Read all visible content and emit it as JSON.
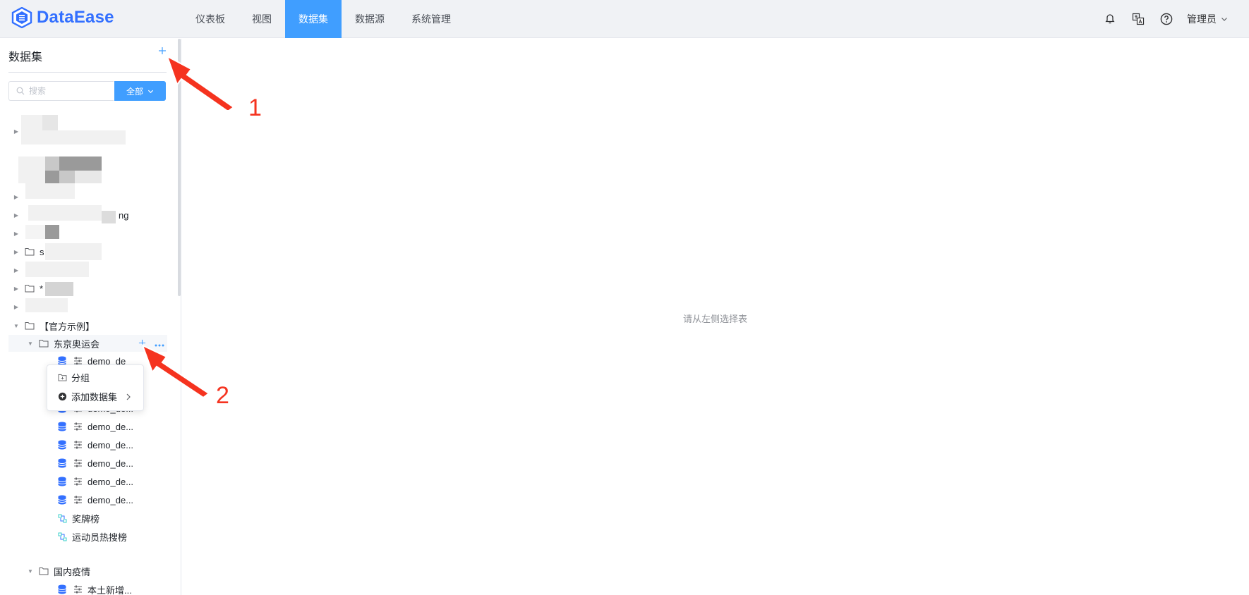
{
  "app": {
    "brand": "DataEase",
    "accent": "#409eff",
    "brand_color": "#3370ff"
  },
  "nav": [
    {
      "label": "仪表板"
    },
    {
      "label": "视图"
    },
    {
      "label": "数据集",
      "active": true
    },
    {
      "label": "数据源"
    },
    {
      "label": "系统管理"
    }
  ],
  "header": {
    "user": "管理员"
  },
  "sidebar": {
    "title": "数据集",
    "search_placeholder": "搜索",
    "filter_label": "全部",
    "partial_rows": [
      {
        "text": "ng"
      },
      {
        "text": "s"
      },
      {
        "text": "*"
      }
    ],
    "folders": {
      "official": "【官方示例】",
      "olympics": "东京奥运会",
      "covid": "国内疫情"
    },
    "datasets": [
      {
        "label": "demo_de"
      },
      {
        "label": "demo_de..."
      },
      {
        "label": "demo_de..."
      },
      {
        "label": "demo_de..."
      },
      {
        "label": "demo_de..."
      },
      {
        "label": "demo_de..."
      },
      {
        "label": "demo_de..."
      },
      {
        "label": "奖牌榜"
      },
      {
        "label": "运动员热搜榜"
      },
      {
        "label": "本土新增..."
      }
    ]
  },
  "popup": {
    "group_label": "分组",
    "add_dataset_label": "添加数据集"
  },
  "main": {
    "empty_text": "请从左侧选择表"
  },
  "annotations": [
    {
      "number": "1"
    },
    {
      "number": "2"
    }
  ]
}
